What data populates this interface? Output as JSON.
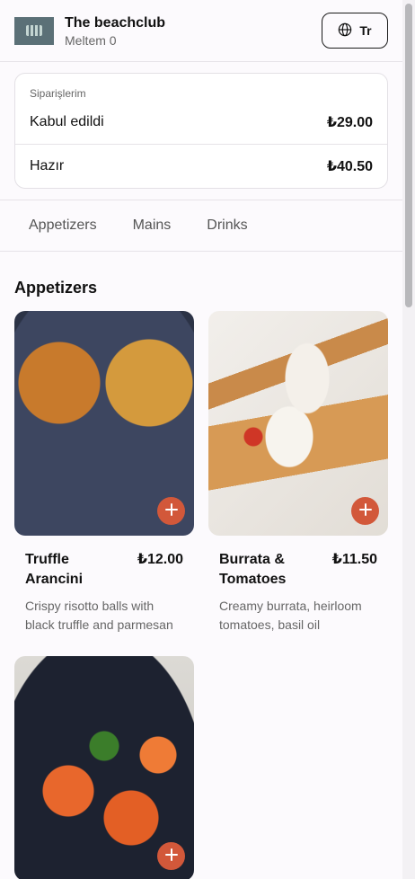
{
  "header": {
    "club_name": "The beachclub",
    "table_name": "Meltem 0",
    "language_label": "Tr",
    "logo_icon": "beachclub-logo"
  },
  "orders": {
    "title": "Siparişlerim",
    "items": [
      {
        "status": "Kabul edildi",
        "total": "₺29.00"
      },
      {
        "status": "Hazır",
        "total": "₺40.50"
      }
    ]
  },
  "tabs": [
    {
      "label": "Appetizers"
    },
    {
      "label": "Mains"
    },
    {
      "label": "Drinks"
    }
  ],
  "section": {
    "title": "Appetizers"
  },
  "menu_items": [
    {
      "name": "Truffle Arancini",
      "price": "₺12.00",
      "description": "Crispy risotto balls with black truffle and parmesan"
    },
    {
      "name": "Burrata & Tomatoes",
      "price": "₺11.50",
      "description": "Creamy burrata, heirloom tomatoes, basil oil"
    },
    {
      "name": "",
      "price": "",
      "description": ""
    }
  ],
  "colors": {
    "accent": "#d2583a",
    "background": "#fcfafd",
    "logo_bg": "#5b7077"
  }
}
